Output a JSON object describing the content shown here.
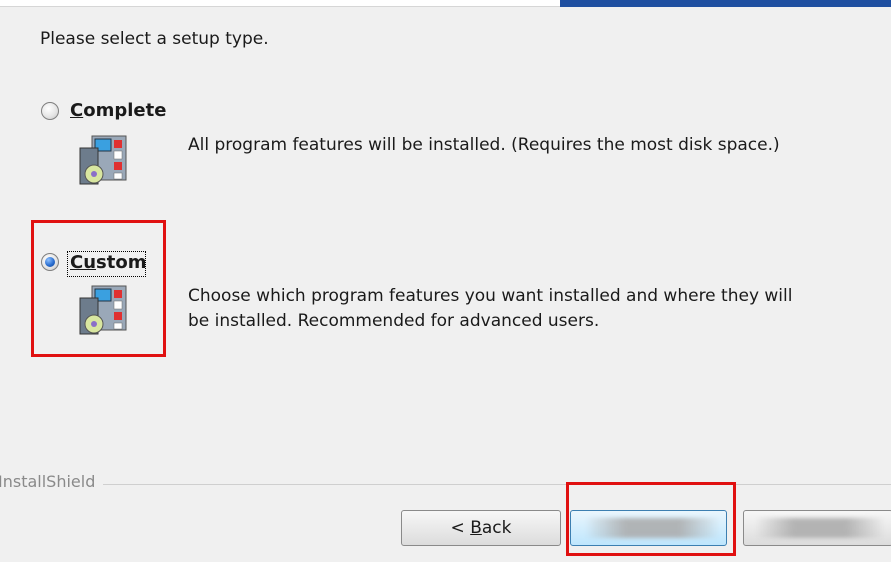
{
  "prompt": "Please select a setup type.",
  "options": [
    {
      "label_first": "C",
      "label_rest": "omplete",
      "selected": false,
      "icon": "installer-package-icon",
      "description": [
        "All program features will be installed. (Requires the most disk space.)"
      ]
    },
    {
      "label_first": "Cu",
      "label_rest": "stom",
      "selected": true,
      "icon": "installer-package-icon",
      "description": [
        "Choose which program features you want installed and where they will",
        "be installed. Recommended for advanced users."
      ]
    }
  ],
  "brand": "InstallShield",
  "buttons": {
    "back_prefix": "< ",
    "back_accel": "B",
    "back_rest": "ack",
    "next_label": "",
    "cancel_label": ""
  },
  "colors": {
    "highlight": "#e01010",
    "accent": "#1f4fa0"
  }
}
